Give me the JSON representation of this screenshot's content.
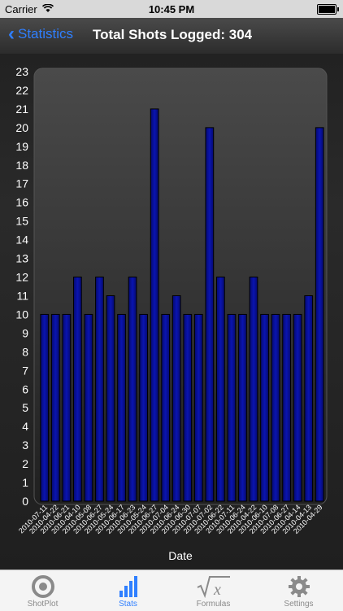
{
  "status_bar": {
    "carrier": "Carrier",
    "time": "10:45 PM"
  },
  "nav": {
    "back_label": "Statistics",
    "title": "Total Shots Logged: 304"
  },
  "tabs": [
    {
      "label": "ShotPlot",
      "icon": "target-icon",
      "active": false
    },
    {
      "label": "Stats",
      "icon": "bar-chart-icon",
      "active": true
    },
    {
      "label": "Formulas",
      "icon": "sqrt-x-icon",
      "active": false
    },
    {
      "label": "Settings",
      "icon": "gear-icon",
      "active": false
    }
  ],
  "colors": {
    "accent": "#2f7fff",
    "bar": "#0a14b0"
  },
  "chart_data": {
    "type": "bar",
    "xlabel": "Date",
    "ylabel": "",
    "ylim": [
      0,
      23
    ],
    "yticks": [
      0,
      1,
      2,
      3,
      4,
      5,
      6,
      7,
      8,
      9,
      10,
      11,
      12,
      13,
      14,
      15,
      16,
      17,
      18,
      19,
      20,
      21,
      22,
      23
    ],
    "categories": [
      "2010-07-11",
      "2010-04-22",
      "2010-06-21",
      "2010-04-10",
      "2010-05-08",
      "2010-06-27",
      "2010-05-24",
      "2010-06-17",
      "2010-06-23",
      "2010-05-24",
      "2010-06-27",
      "2010-07-04",
      "2010-06-24",
      "2010-06-30",
      "2010-07-07",
      "2010-07-02",
      "2010-06-22",
      "2010-07-11",
      "2010-06-24",
      "2010-04-22",
      "2010-06-10",
      "2010-07-08",
      "2010-06-27",
      "2010-04-14",
      "2010-04-13",
      "2010-04-29"
    ],
    "values": [
      10,
      10,
      10,
      12,
      10,
      12,
      11,
      10,
      12,
      10,
      21,
      10,
      11,
      10,
      10,
      20,
      12,
      10,
      10,
      12,
      10,
      10,
      10,
      10,
      11,
      20
    ]
  }
}
